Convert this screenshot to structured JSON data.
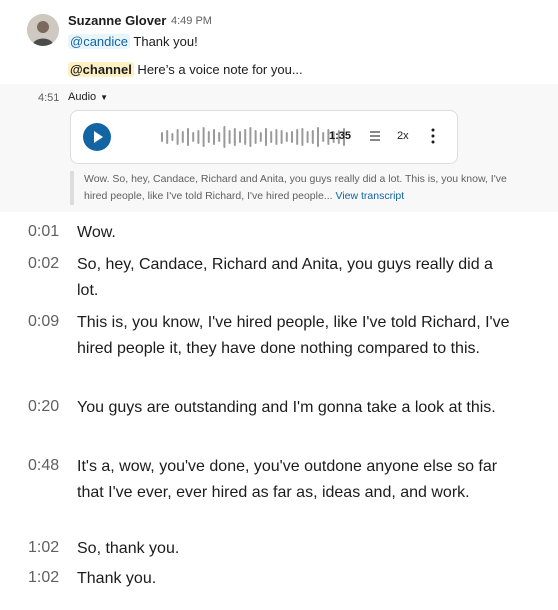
{
  "message": {
    "author": "Suzanne Glover",
    "time": "4:49 PM",
    "mention_user": "@candice",
    "line1_text": " Thank you!",
    "mention_channel": "@channel",
    "line2_text": " Here’s a voice note for you..."
  },
  "audio": {
    "timestamp": "4:51",
    "label": "Audio",
    "duration": "1:35",
    "speed": "2x",
    "snippet": "Wow. So, hey, Candace, Richard and Anita, you guys really did a lot. This is, you know, I've hired people, like I've told Richard, I've hired people...",
    "view_transcript": "View transcript",
    "colors": {
      "accent": "#1264a3",
      "wave": "#9a9a9a"
    },
    "icons": {
      "play": "play-icon",
      "menu": "transcript-lines-icon",
      "more": "more-vertical-icon"
    }
  },
  "transcript": [
    {
      "time": "0:01",
      "text": "Wow."
    },
    {
      "time": "0:02",
      "text": "So, hey, Candace, Richard and Anita, you guys really did a lot."
    },
    {
      "time": "0:09",
      "text": "This is, you know, I've hired people, like I've told Richard, I've hired people it, they have done nothing compared to this."
    },
    {
      "time": "0:20",
      "text": "You guys are outstanding and I'm gonna take a look at this."
    },
    {
      "time": "0:48",
      "text": "It's a, wow, you've done, you've outdone anyone else so far that I've ever, ever hired as far as, ideas and, and work."
    },
    {
      "time": "1:02",
      "text": "So, thank you."
    },
    {
      "time": "1:02",
      "text": "Thank you."
    }
  ]
}
